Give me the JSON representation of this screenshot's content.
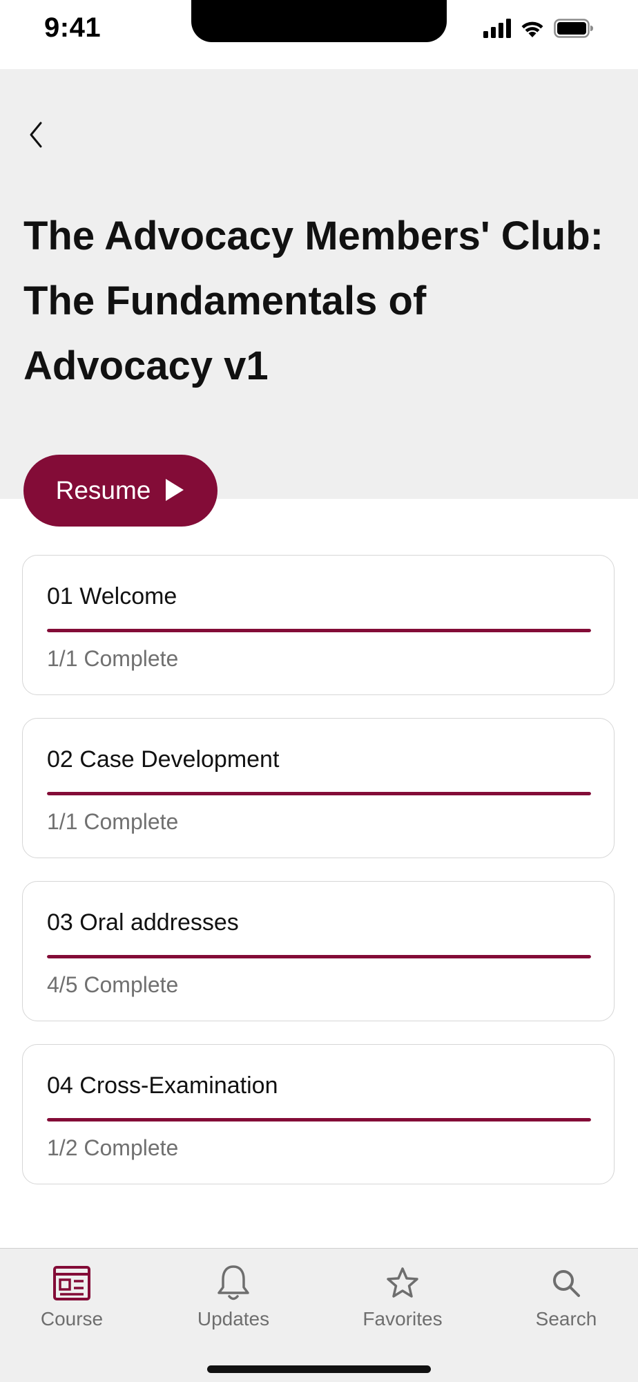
{
  "status_bar": {
    "time": "9:41"
  },
  "header": {
    "back_icon": "chevron-left-icon",
    "title": "The Advocacy Members' Club: The Fundamentals of Advocacy v1"
  },
  "resume_button": {
    "label": "Resume",
    "icon": "play-icon"
  },
  "modules": [
    {
      "title": "01 Welcome",
      "status": "1/1 Complete",
      "progress": 1.0
    },
    {
      "title": "02 Case Development",
      "status": "1/1 Complete",
      "progress": 1.0
    },
    {
      "title": "03 Oral addresses",
      "status": "4/5 Complete",
      "progress": 1.0
    },
    {
      "title": "04 Cross-Examination",
      "status": "1/2 Complete",
      "progress": 1.0
    }
  ],
  "tab_bar": {
    "tabs": [
      {
        "label": "Course",
        "icon": "course-icon",
        "active": true
      },
      {
        "label": "Updates",
        "icon": "bell-icon",
        "active": false
      },
      {
        "label": "Favorites",
        "icon": "star-icon",
        "active": false
      },
      {
        "label": "Search",
        "icon": "search-icon",
        "active": false
      }
    ]
  },
  "colors": {
    "accent": "#830c37",
    "header_bg": "#efefef",
    "muted_text": "#707070",
    "card_border": "#d6d6d6"
  }
}
